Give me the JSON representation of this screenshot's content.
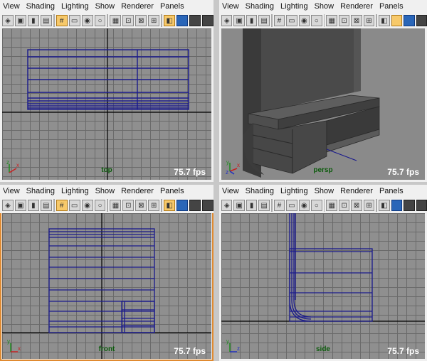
{
  "menu_items": [
    "View",
    "Shading",
    "Lighting",
    "Show",
    "Renderer",
    "Panels"
  ],
  "fps": "75.7 fps",
  "panels": {
    "top": {
      "camera": "top"
    },
    "persp": {
      "camera": "persp"
    },
    "front": {
      "camera": "front"
    },
    "side": {
      "camera": "side"
    }
  },
  "toolbar_icons": [
    "select-camera-icon",
    "camera-attributes-icon",
    "bookmark-icon",
    "image-plane-icon",
    "grid-icon",
    "film-gate-icon",
    "resolution-gate-icon",
    "gate-mask-icon",
    "field-chart-icon",
    "safe-action-icon",
    "safe-title-icon",
    "wireframe-icon",
    "smooth-shade-icon",
    "flat-shade-icon",
    "default-material-icon"
  ],
  "colors": {
    "active_border": "#e08a30",
    "wireframe": "#1a1a8c",
    "fps_text": "#ffffff",
    "camera_label": "#0c5b0c"
  }
}
